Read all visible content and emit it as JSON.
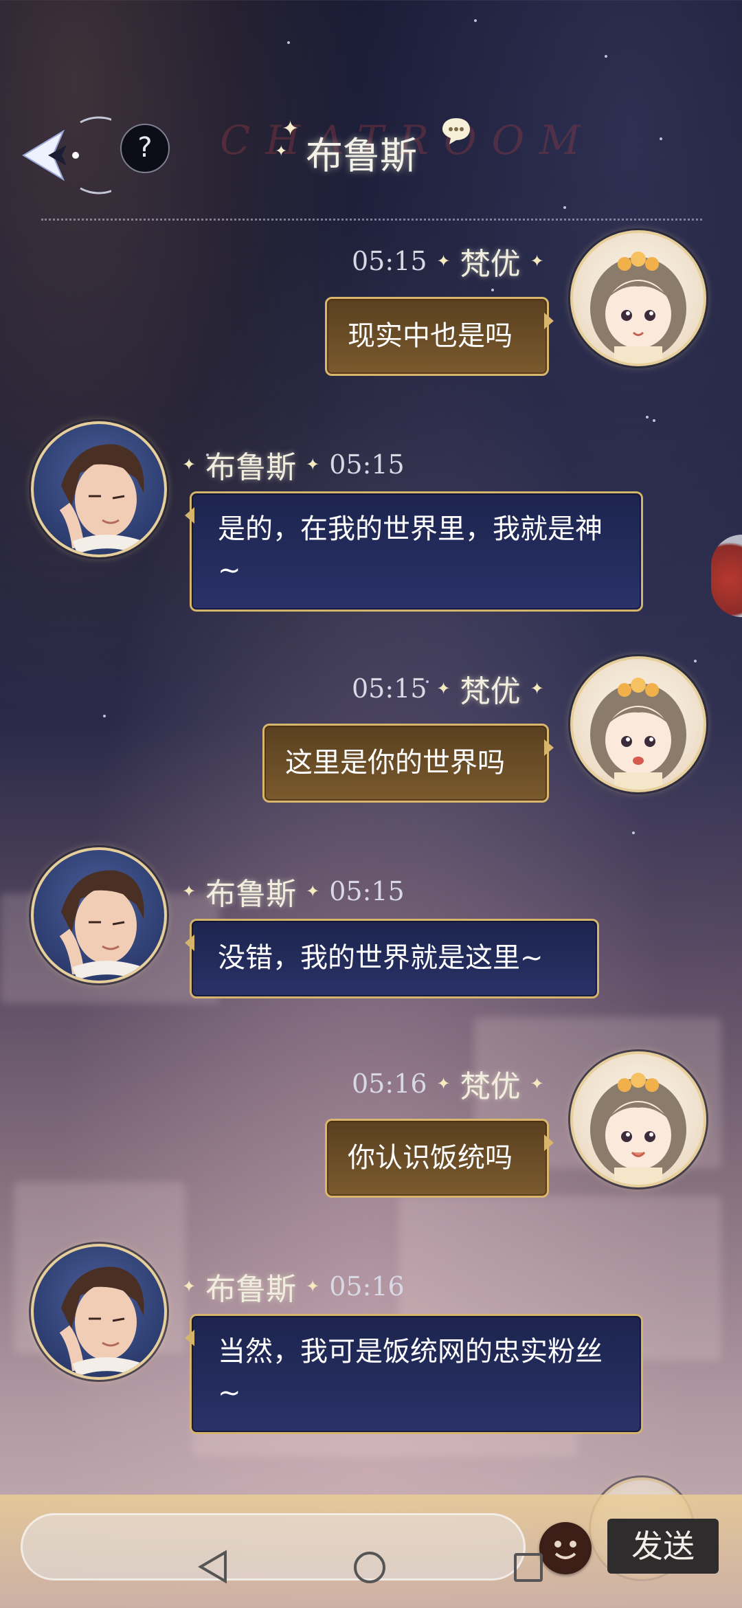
{
  "header": {
    "title": "布鲁斯",
    "watermark": "CHATROOM",
    "help_label": "?"
  },
  "messages": [
    {
      "side": "mine",
      "time": "05:15",
      "name": "梵优",
      "text": "现实中也是吗"
    },
    {
      "side": "theirs",
      "time": "05:15",
      "name": "布鲁斯",
      "text": "是的，在我的世界里，我就是神~"
    },
    {
      "side": "mine",
      "time": "05:15",
      "name": "梵优",
      "text": "这里是你的世界吗"
    },
    {
      "side": "theirs",
      "time": "05:15",
      "name": "布鲁斯",
      "text": "没错，我的世界就是这里~"
    },
    {
      "side": "mine",
      "time": "05:16",
      "name": "梵优",
      "text": "你认识饭统吗"
    },
    {
      "side": "theirs",
      "time": "05:16",
      "name": "布鲁斯",
      "text": "当然，我可是饭统网的忠实粉丝~"
    }
  ],
  "input": {
    "placeholder": "",
    "send_label": "发送"
  },
  "icons": {
    "back": "back-arrow-icon",
    "help": "question-icon",
    "title_badge": "chat-bubble-icon",
    "emoji": "emoji-icon"
  },
  "colors": {
    "bubble_border_gold": "#d8b66e",
    "my_bubble": "#6a4c26",
    "their_bubble": "#232b5b"
  }
}
